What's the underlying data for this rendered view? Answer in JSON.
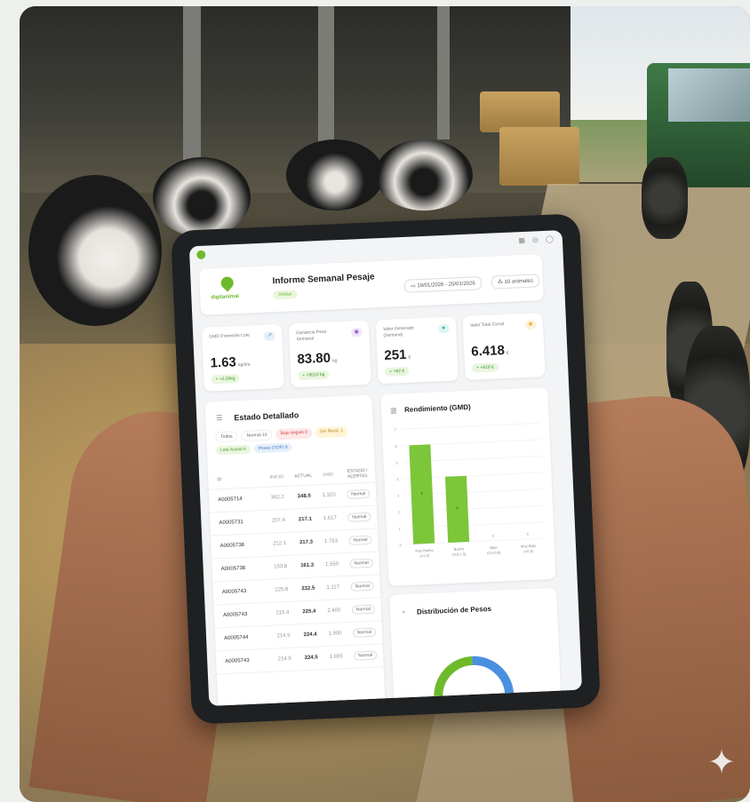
{
  "app": {
    "brand": "digitanimal",
    "report_title": "Informe Semanal Pesaje",
    "report_tag": "Ahlikat",
    "date_range": "19/01/2026 - 25/01/2026",
    "animal_count": "10 animales",
    "topbar_icons": [
      "grid-icon",
      "bell-icon",
      "user-icon"
    ]
  },
  "kpis": [
    {
      "label": "GMD Promedio Lote",
      "value": "1.63",
      "unit": "kg/día",
      "badge": "+ +0.20kg",
      "icon": "trend-icon",
      "color": "#5b9bd5"
    },
    {
      "label": "Ganancia Peso Semanal",
      "value": "83.80",
      "unit": "kg",
      "badge": "+ +8010 kg",
      "icon": "scale-icon",
      "color": "#a268d8"
    },
    {
      "label": "Valor Generado (Semana)",
      "value": "251",
      "unit": "€",
      "badge": "+ +82 €",
      "icon": "money-icon",
      "color": "#34b8a8"
    },
    {
      "label": "Valor Total Corral",
      "value": "6.418",
      "unit": "€",
      "badge": "+ +818 €",
      "icon": "wallet-icon",
      "color": "#f0b340"
    }
  ],
  "detail": {
    "title": "Estado Detallado",
    "filters": [
      {
        "label": "Todos",
        "bg": "#ffffff",
        "fg": "#666"
      },
      {
        "label": "Normal 10",
        "bg": "#ffffff",
        "fg": "#666"
      },
      {
        "label": "Bajo ángulo 0",
        "bg": "#fde8e8",
        "fg": "#d04848"
      },
      {
        "label": "Sin Rend. 1",
        "bg": "#fff4d6",
        "fg": "#b88a18"
      },
      {
        "label": "Lote Actual 4",
        "bg": "#eaf6df",
        "fg": "#4a9a2a"
      },
      {
        "label": "Peses (TOP) 8",
        "bg": "#e6f0fb",
        "fg": "#3a7ac8"
      }
    ],
    "columns": [
      "ID",
      "INICIO",
      "ACTUAL",
      "GMD",
      "ESTADO / ALERTAS"
    ],
    "rows": [
      {
        "id": "A0005714",
        "inicio": "342.2",
        "actual": "348.5",
        "gmd": "1.320",
        "estado": "Normal"
      },
      {
        "id": "A0005731",
        "inicio": "207.4",
        "actual": "217.1",
        "gmd": "1.617",
        "estado": "Normal"
      },
      {
        "id": "A0005738",
        "inicio": "212.1",
        "actual": "217.3",
        "gmd": "1.753",
        "estado": "Normal"
      },
      {
        "id": "A0005738",
        "inicio": "153.8",
        "actual": "161.3",
        "gmd": "1.550",
        "estado": "Normal"
      },
      {
        "id": "A0005743",
        "inicio": "225.8",
        "actual": "232.5",
        "gmd": "1.117",
        "estado": "Normal"
      },
      {
        "id": "A0005743",
        "inicio": "215.4",
        "actual": "225.4",
        "gmd": "2.400",
        "estado": "Normal"
      },
      {
        "id": "A0005744",
        "inicio": "214.9",
        "actual": "224.4",
        "gmd": "1.900",
        "estado": "Normal"
      },
      {
        "id": "A0005743",
        "inicio": "214.9",
        "actual": "224.5",
        "gmd": "1.655",
        "estado": "Normal"
      }
    ]
  },
  "performance": {
    "title": "Rendimiento (GMD)"
  },
  "distribution": {
    "title": "Distribución de Pesos",
    "ring_colors": [
      "#6fba2c",
      "#4a8fe0"
    ]
  },
  "chart_data": {
    "type": "bar",
    "title": "Rendimiento (GMD)",
    "categories": [
      "Muy Bueno (>1.5)",
      "Bueno (0.8-1.5)",
      "Bajo (0.3-0.8)",
      "Muy Bajo (<0.3)"
    ],
    "values": [
      6,
      4,
      0,
      0
    ],
    "ylim": [
      0,
      7
    ],
    "bar_color": "#7cc63a"
  }
}
